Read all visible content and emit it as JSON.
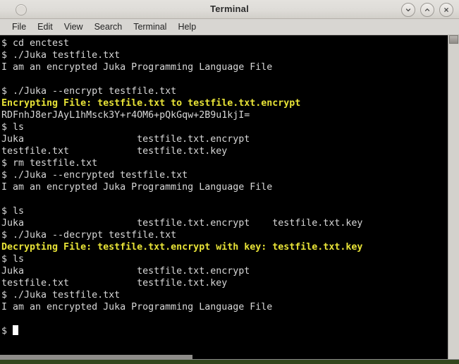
{
  "window": {
    "title": "Terminal",
    "controls": [
      {
        "name": "minimize",
        "glyph": "⌄"
      },
      {
        "name": "maximize",
        "glyph": "⌃"
      },
      {
        "name": "close",
        "glyph": "✕"
      }
    ]
  },
  "menubar": {
    "items": [
      "File",
      "Edit",
      "View",
      "Search",
      "Terminal",
      "Help"
    ]
  },
  "terminal": {
    "colors": {
      "background": "#000000",
      "foreground": "#d8d8d8",
      "highlight": "#e8e337",
      "cursor": "#ffffff"
    },
    "lines": [
      {
        "text": "$ cd enctest",
        "style": "normal"
      },
      {
        "text": "$ ./Juka testfile.txt",
        "style": "normal"
      },
      {
        "text": "I am an encrypted Juka Programming Language File",
        "style": "normal"
      },
      {
        "text": "",
        "style": "normal"
      },
      {
        "text": "$ ./Juka --encrypt testfile.txt",
        "style": "normal"
      },
      {
        "text": "Encrypting File: testfile.txt to testfile.txt.encrypt",
        "style": "bold-yellow"
      },
      {
        "text": "RDFnhJ8erJAyL1hMsck3Y+r4OM6+pQkGqw+2B9u1kjI=",
        "style": "normal"
      },
      {
        "text": "$ ls",
        "style": "normal"
      },
      {
        "text": "Juka                    testfile.txt.encrypt",
        "style": "normal"
      },
      {
        "text": "testfile.txt            testfile.txt.key",
        "style": "normal"
      },
      {
        "text": "$ rm testfile.txt",
        "style": "normal"
      },
      {
        "text": "$ ./Juka --encrypted testfile.txt",
        "style": "normal"
      },
      {
        "text": "I am an encrypted Juka Programming Language File",
        "style": "normal"
      },
      {
        "text": "",
        "style": "normal"
      },
      {
        "text": "$ ls",
        "style": "normal"
      },
      {
        "text": "Juka                    testfile.txt.encrypt    testfile.txt.key",
        "style": "normal"
      },
      {
        "text": "$ ./Juka --decrypt testfile.txt",
        "style": "normal"
      },
      {
        "text": "Decrypting File: testfile.txt.encrypt with key: testfile.txt.key",
        "style": "bold-yellow"
      },
      {
        "text": "$ ls",
        "style": "normal"
      },
      {
        "text": "Juka                    testfile.txt.encrypt",
        "style": "normal"
      },
      {
        "text": "testfile.txt            testfile.txt.key",
        "style": "normal"
      },
      {
        "text": "$ ./Juka testfile.txt",
        "style": "normal"
      },
      {
        "text": "I am an encrypted Juka Programming Language File",
        "style": "normal"
      },
      {
        "text": "",
        "style": "normal"
      }
    ],
    "prompt": "$ "
  }
}
